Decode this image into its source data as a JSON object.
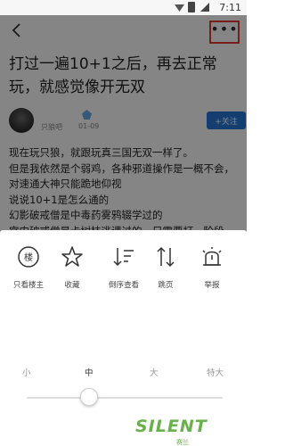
{
  "status_bar": {
    "time": "7:11"
  },
  "post": {
    "title": "打过一遍10+1之后，再去正常玩，就感觉像开无双",
    "author": "只狼吧",
    "date": "01-09",
    "follow_label": "+关注",
    "body": [
      "现在玩只狼，就跟玩真三国无双一样了。",
      "但是我依然是个弱鸡，各种邪道操作是一概不会，对速通大神只能跪地仰视",
      "说说10+1是怎么通的",
      "幻影破戒僧是中毒药雾鸦辍学过的",
      "宫内破戒僧是卡树枝逃课过的，只需要打一阶段，打完他就掉悬崖死了"
    ]
  },
  "actions": [
    {
      "label": "只看楼主",
      "icon": "only-author-icon"
    },
    {
      "label": "收藏",
      "icon": "star-icon"
    },
    {
      "label": "倒序查看",
      "icon": "reverse-sort-icon"
    },
    {
      "label": "跳页",
      "icon": "jump-page-icon"
    },
    {
      "label": "举报",
      "icon": "report-icon"
    }
  ],
  "font_size": {
    "options": [
      "小",
      "中",
      "大",
      "特大"
    ],
    "selected": "中"
  },
  "watermark": {
    "brand": "SILENT",
    "sub": "赛兰"
  }
}
